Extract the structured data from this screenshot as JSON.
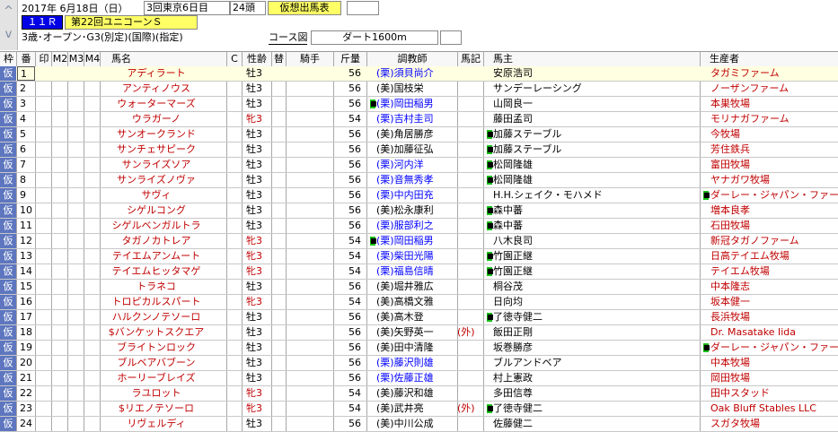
{
  "header": {
    "date": "2017年  6月18日（日）",
    "meeting": "3回東京6日目",
    "heads": "24頭",
    "mode_label": "仮想出馬表",
    "race_no": "１１Ｒ",
    "race_name": "第22回ユニコーンＳ",
    "conditions": "3歳･オープン･G3(別定)(国際)(指定)",
    "course_button": "コース図",
    "course": "ダート1600m"
  },
  "nav": {
    "up_icon": "^",
    "down_icon": "v"
  },
  "columns": {
    "waku": "枠",
    "ban": "番",
    "shirushi": "印",
    "m2": "M2",
    "m3": "M3",
    "m4": "M4",
    "horse": "馬名",
    "c": "C",
    "sexage": "性齢",
    "kae": "替",
    "jockey": "騎手",
    "weight": "斤量",
    "trainer": "調教師",
    "umaki": "馬記",
    "owner": "馬主",
    "breeder": "生産者"
  },
  "colors": {
    "kari_bg": "#5d76bf",
    "highlight": "#ffffe1",
    "red": "#c00000",
    "blue": "#0000ff",
    "mark_green": "#19c419"
  },
  "rows": [
    {
      "kari": "仮",
      "no": "1",
      "horse": "アディラート",
      "sexage": "牡3",
      "weight": "56",
      "trainer": "(栗)須貝尚介",
      "owner": "安原浩司",
      "breeder": "タガミファーム",
      "hl": true,
      "sel": true,
      "sexred": false,
      "tblue": true,
      "tmark": false,
      "omark": false,
      "bmark": false,
      "gaikoku": ""
    },
    {
      "kari": "仮",
      "no": "2",
      "horse": "アンティノウス",
      "sexage": "牡3",
      "weight": "56",
      "trainer": "(美)国枝栄",
      "owner": "サンデーレーシング",
      "breeder": "ノーザンファーム",
      "hl": false,
      "sel": false,
      "sexred": false,
      "tblue": false,
      "tmark": false,
      "omark": false,
      "bmark": false,
      "gaikoku": ""
    },
    {
      "kari": "仮",
      "no": "3",
      "horse": "ウォーターマーズ",
      "sexage": "牡3",
      "weight": "56",
      "trainer": "(栗)岡田稲男",
      "owner": "山岡良一",
      "breeder": "本巣牧場",
      "hl": false,
      "sel": false,
      "sexred": false,
      "tblue": true,
      "tmark": true,
      "omark": false,
      "bmark": false,
      "gaikoku": ""
    },
    {
      "kari": "仮",
      "no": "4",
      "horse": "ウラガーノ",
      "sexage": "牝3",
      "weight": "54",
      "trainer": "(栗)吉村圭司",
      "owner": "藤田孟司",
      "breeder": "モリナガファーム",
      "hl": false,
      "sel": false,
      "sexred": true,
      "tblue": true,
      "tmark": false,
      "omark": false,
      "bmark": false,
      "gaikoku": ""
    },
    {
      "kari": "仮",
      "no": "5",
      "horse": "サンオークランド",
      "sexage": "牡3",
      "weight": "56",
      "trainer": "(美)角居勝彦",
      "owner": "加藤ステーブル",
      "breeder": "今牧場",
      "hl": false,
      "sel": false,
      "sexred": false,
      "tblue": false,
      "tmark": false,
      "omark": true,
      "bmark": false,
      "gaikoku": ""
    },
    {
      "kari": "仮",
      "no": "6",
      "horse": "サンチェサピーク",
      "sexage": "牡3",
      "weight": "56",
      "trainer": "(美)加藤征弘",
      "owner": "加藤ステーブル",
      "breeder": "芳住鉄兵",
      "hl": false,
      "sel": false,
      "sexred": false,
      "tblue": false,
      "tmark": false,
      "omark": true,
      "bmark": false,
      "gaikoku": ""
    },
    {
      "kari": "仮",
      "no": "7",
      "horse": "サンライズソア",
      "sexage": "牡3",
      "weight": "56",
      "trainer": "(栗)河内洋",
      "owner": "松岡隆雄",
      "breeder": "富田牧場",
      "hl": false,
      "sel": false,
      "sexred": false,
      "tblue": true,
      "tmark": false,
      "omark": true,
      "bmark": false,
      "gaikoku": ""
    },
    {
      "kari": "仮",
      "no": "8",
      "horse": "サンライズノヴァ",
      "sexage": "牡3",
      "weight": "56",
      "trainer": "(栗)音無秀孝",
      "owner": "松岡隆雄",
      "breeder": "ヤナガワ牧場",
      "hl": false,
      "sel": false,
      "sexred": false,
      "tblue": true,
      "tmark": false,
      "omark": true,
      "bmark": false,
      "gaikoku": ""
    },
    {
      "kari": "仮",
      "no": "9",
      "horse": "サヴィ",
      "sexage": "牡3",
      "weight": "56",
      "trainer": "(栗)中内田充",
      "owner": "H.H.シェイク・モハメド",
      "breeder": "ダーレー・ジャパン・ファーム",
      "hl": false,
      "sel": false,
      "sexred": false,
      "tblue": true,
      "tmark": false,
      "omark": false,
      "bmark": true,
      "gaikoku": ""
    },
    {
      "kari": "仮",
      "no": "10",
      "horse": "シゲルコング",
      "sexage": "牡3",
      "weight": "56",
      "trainer": "(美)松永康利",
      "owner": "森中蕃",
      "breeder": "増本良孝",
      "hl": false,
      "sel": false,
      "sexred": false,
      "tblue": false,
      "tmark": false,
      "omark": true,
      "bmark": false,
      "gaikoku": ""
    },
    {
      "kari": "仮",
      "no": "11",
      "horse": "シゲルベンガルトラ",
      "sexage": "牡3",
      "weight": "56",
      "trainer": "(栗)服部利之",
      "owner": "森中蕃",
      "breeder": "石田牧場",
      "hl": false,
      "sel": false,
      "sexred": false,
      "tblue": true,
      "tmark": false,
      "omark": true,
      "bmark": false,
      "gaikoku": ""
    },
    {
      "kari": "仮",
      "no": "12",
      "horse": "タガノカトレア",
      "sexage": "牝3",
      "weight": "54",
      "trainer": "(栗)岡田稲男",
      "owner": "八木良司",
      "breeder": "新冠タガノファーム",
      "hl": false,
      "sel": false,
      "sexred": true,
      "tblue": true,
      "tmark": true,
      "omark": false,
      "bmark": false,
      "gaikoku": ""
    },
    {
      "kari": "仮",
      "no": "13",
      "horse": "テイエムアンムート",
      "sexage": "牝3",
      "weight": "54",
      "trainer": "(栗)柴田光陽",
      "owner": "竹園正継",
      "breeder": "日高テイエム牧場",
      "hl": false,
      "sel": false,
      "sexred": true,
      "tblue": true,
      "tmark": false,
      "omark": true,
      "bmark": false,
      "gaikoku": ""
    },
    {
      "kari": "仮",
      "no": "14",
      "horse": "テイエムヒッタマゲ",
      "sexage": "牝3",
      "weight": "54",
      "trainer": "(栗)福島信晴",
      "owner": "竹園正継",
      "breeder": "テイエム牧場",
      "hl": false,
      "sel": false,
      "sexred": true,
      "tblue": true,
      "tmark": false,
      "omark": true,
      "bmark": false,
      "gaikoku": ""
    },
    {
      "kari": "仮",
      "no": "15",
      "horse": "トラネコ",
      "sexage": "牡3",
      "weight": "56",
      "trainer": "(美)堀井雅広",
      "owner": "桐谷茂",
      "breeder": "中本隆志",
      "hl": false,
      "sel": false,
      "sexred": false,
      "tblue": false,
      "tmark": false,
      "omark": false,
      "bmark": false,
      "gaikoku": ""
    },
    {
      "kari": "仮",
      "no": "16",
      "horse": "トロピカルスパート",
      "sexage": "牝3",
      "weight": "54",
      "trainer": "(美)高橋文雅",
      "owner": "日向均",
      "breeder": "坂本健一",
      "hl": false,
      "sel": false,
      "sexred": true,
      "tblue": false,
      "tmark": false,
      "omark": false,
      "bmark": false,
      "gaikoku": ""
    },
    {
      "kari": "仮",
      "no": "17",
      "horse": "ハルクンノテソーロ",
      "sexage": "牡3",
      "weight": "56",
      "trainer": "(美)高木登",
      "owner": "了徳寺健二",
      "breeder": "長浜牧場",
      "hl": false,
      "sel": false,
      "sexred": false,
      "tblue": false,
      "tmark": false,
      "omark": true,
      "bmark": false,
      "gaikoku": ""
    },
    {
      "kari": "仮",
      "no": "18",
      "horse": "$バンケットスクエア",
      "sexage": "牡3",
      "weight": "56",
      "trainer": "(美)矢野英一",
      "owner": "飯田正剛",
      "breeder": "Dr. Masatake Iida",
      "hl": false,
      "sel": false,
      "sexred": false,
      "tblue": false,
      "tmark": false,
      "omark": false,
      "bmark": false,
      "gaikoku": "(外)"
    },
    {
      "kari": "仮",
      "no": "19",
      "horse": "ブライトンロック",
      "sexage": "牡3",
      "weight": "56",
      "trainer": "(美)田中清隆",
      "owner": "坂巻勝彦",
      "breeder": "ダーレー・ジャパン・ファーム",
      "hl": false,
      "sel": false,
      "sexred": false,
      "tblue": false,
      "tmark": false,
      "omark": false,
      "bmark": true,
      "gaikoku": ""
    },
    {
      "kari": "仮",
      "no": "20",
      "horse": "ブルベアバブーン",
      "sexage": "牡3",
      "weight": "56",
      "trainer": "(栗)藤沢則雄",
      "owner": "ブルアンドベア",
      "breeder": "中本牧場",
      "hl": false,
      "sel": false,
      "sexred": false,
      "tblue": true,
      "tmark": false,
      "omark": false,
      "bmark": false,
      "gaikoku": ""
    },
    {
      "kari": "仮",
      "no": "21",
      "horse": "ホーリーブレイズ",
      "sexage": "牡3",
      "weight": "56",
      "trainer": "(栗)佐藤正雄",
      "owner": "村上憲政",
      "breeder": "岡田牧場",
      "hl": false,
      "sel": false,
      "sexred": false,
      "tblue": true,
      "tmark": false,
      "omark": false,
      "bmark": false,
      "gaikoku": ""
    },
    {
      "kari": "仮",
      "no": "22",
      "horse": "ラユロット",
      "sexage": "牝3",
      "weight": "54",
      "trainer": "(美)藤沢和雄",
      "owner": "多田信尊",
      "breeder": "田中スタッド",
      "hl": false,
      "sel": false,
      "sexred": true,
      "tblue": false,
      "tmark": false,
      "omark": false,
      "bmark": false,
      "gaikoku": ""
    },
    {
      "kari": "仮",
      "no": "23",
      "horse": "$リエノテソーロ",
      "sexage": "牝3",
      "weight": "54",
      "trainer": "(美)武井亮",
      "owner": "了徳寺健二",
      "breeder": "Oak Bluff Stables LLC",
      "hl": false,
      "sel": false,
      "sexred": true,
      "tblue": false,
      "tmark": false,
      "omark": true,
      "bmark": false,
      "gaikoku": "(外)"
    },
    {
      "kari": "仮",
      "no": "24",
      "horse": "リヴェルディ",
      "sexage": "牡3",
      "weight": "56",
      "trainer": "(美)中川公成",
      "owner": "佐藤健二",
      "breeder": "スガタ牧場",
      "hl": false,
      "sel": false,
      "sexred": false,
      "tblue": false,
      "tmark": false,
      "omark": false,
      "bmark": false,
      "gaikoku": ""
    }
  ]
}
